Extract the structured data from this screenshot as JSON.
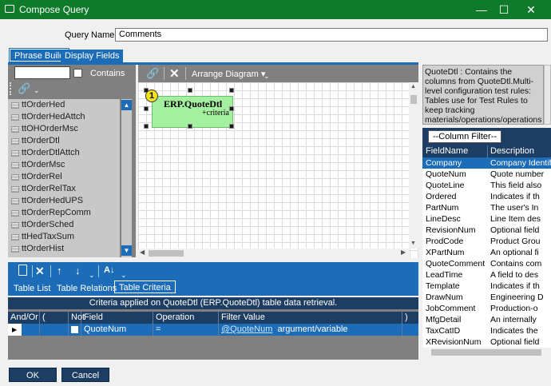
{
  "window": {
    "title": "Compose Query",
    "minimize": "—",
    "maximize": "☐",
    "close": "✕"
  },
  "query_name": {
    "label": "Query Name:",
    "value": "Comments"
  },
  "top_tabs": [
    {
      "label": "Phrase Build"
    },
    {
      "label": "Display Fields"
    }
  ],
  "left_panel": {
    "contains_label": "Contains",
    "tables": [
      "ttOrderHed",
      "ttOrderHedAttch",
      "ttOHOrderMsc",
      "ttOrderDtl",
      "ttOrderDtlAttch",
      "ttOrderMsc",
      "ttOrderRel",
      "ttOrderRelTax",
      "ttOrderHedUPS",
      "ttOrderRepComm",
      "ttOrderSched",
      "ttHedTaxSum",
      "ttOrderHist"
    ]
  },
  "diagram": {
    "arrange_label": "Arrange Diagram",
    "box_title": "ERP.QuoteDtl",
    "box_criteria": "+criteria",
    "badge": "1"
  },
  "bottom_tabs": [
    {
      "label": "Table List"
    },
    {
      "label": "Table Relations"
    },
    {
      "label": "Table Criteria"
    }
  ],
  "criteria": {
    "header": "Criteria applied on QuoteDtl (ERP.QuoteDtl)  table data retrieval.",
    "columns": [
      "And/Or",
      "(",
      "Not",
      "Field",
      "Operation",
      "Filter Value",
      ")"
    ],
    "row": {
      "field": "QuoteNum",
      "operation": "=",
      "filter_link": "@QuoteNum",
      "filter_suffix": "argument/variable"
    }
  },
  "right_panel": {
    "description": "QuoteDtl : Contains the columns from QuoteDtl.Multi-level configuration test rules: Tables use for Test Rules to keep tracking materials/operations/operations details when next configuration is l",
    "column_filter": "--Column Filter--",
    "headers": [
      "FieldName",
      "Description"
    ],
    "fields": [
      {
        "name": "Company",
        "desc": "Company Identifier"
      },
      {
        "name": "QuoteNum",
        "desc": "Quote number"
      },
      {
        "name": "QuoteLine",
        "desc": "This field also"
      },
      {
        "name": "Ordered",
        "desc": "Indicates if th"
      },
      {
        "name": "PartNum",
        "desc": "The user's In"
      },
      {
        "name": "LineDesc",
        "desc": "Line Item des"
      },
      {
        "name": "RevisionNum",
        "desc": "Optional field"
      },
      {
        "name": "ProdCode",
        "desc": "Product Grou"
      },
      {
        "name": "XPartNum",
        "desc": "An optional fi"
      },
      {
        "name": "QuoteComment",
        "desc": "Contains com"
      },
      {
        "name": "LeadTime",
        "desc": "A field to des"
      },
      {
        "name": "Template",
        "desc": "Indicates if th"
      },
      {
        "name": "DrawNum",
        "desc": "Engineering D"
      },
      {
        "name": "JobComment",
        "desc": "Production-o"
      },
      {
        "name": "MfgDetail",
        "desc": "An internally"
      },
      {
        "name": "TaxCatID",
        "desc": "Indicates the"
      },
      {
        "name": "XRevisionNum",
        "desc": "Optional field"
      }
    ]
  },
  "buttons": {
    "ok": "OK",
    "cancel": "Cancel"
  }
}
